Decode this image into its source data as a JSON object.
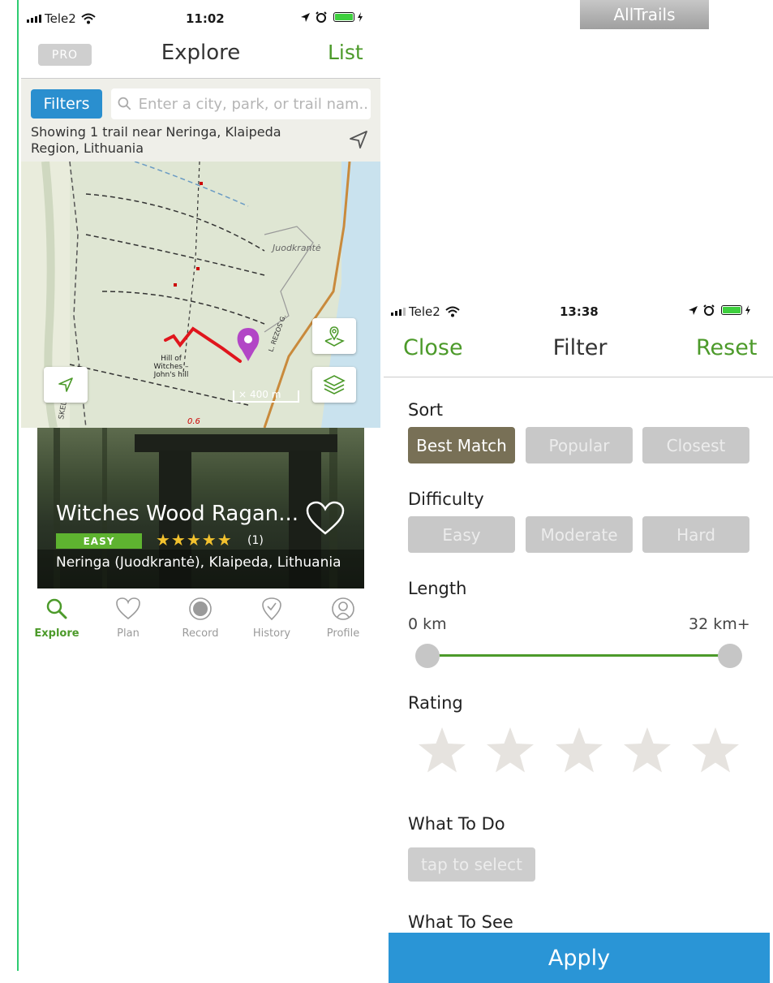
{
  "left_screen": {
    "status": {
      "carrier": "Tele2",
      "time": "11:02"
    },
    "nav": {
      "pro_label": "PRO",
      "title": "Explore",
      "list_label": "List"
    },
    "search": {
      "filters_label": "Filters",
      "placeholder": "Enter a city, park, or trail nam..."
    },
    "showing_text": "Showing 1 trail near Neringa, Klaipeda Region, Lithuania",
    "map": {
      "town_label": "Juodkrantė",
      "landmark_label_1": "Hill of",
      "landmark_label_2": "Witches –",
      "landmark_label_3": "John's hill",
      "road_label": "L. REZOS G.",
      "scale_label": "400 m",
      "side_label": "SKEL",
      "distance_label": "0.6"
    },
    "trail_card": {
      "name": "Witches Wood Ragan...",
      "difficulty": "EASY",
      "stars": "★★★★★",
      "rating_count": "(1)",
      "location": "Neringa (Juodkrantė), Klaipeda, Lithuania"
    },
    "tabs": [
      {
        "label": "Explore",
        "icon": "search-icon",
        "active": true
      },
      {
        "label": "Plan",
        "icon": "heart-icon",
        "active": false
      },
      {
        "label": "Record",
        "icon": "record-icon",
        "active": false
      },
      {
        "label": "History",
        "icon": "history-icon",
        "active": false
      },
      {
        "label": "Profile",
        "icon": "profile-icon",
        "active": false
      }
    ]
  },
  "brand_banner": "AllTrails",
  "right_screen": {
    "status": {
      "carrier": "Tele2",
      "time": "13:38"
    },
    "nav": {
      "close_label": "Close",
      "title": "Filter",
      "reset_label": "Reset"
    },
    "sort": {
      "heading": "Sort",
      "options": [
        "Best Match",
        "Popular",
        "Closest"
      ],
      "selected": "Best Match"
    },
    "difficulty": {
      "heading": "Difficulty",
      "options": [
        "Easy",
        "Moderate",
        "Hard"
      ]
    },
    "length": {
      "heading": "Length",
      "min_label": "0 km",
      "max_label": "32 km+"
    },
    "rating": {
      "heading": "Rating",
      "stars": 5,
      "selected": 0
    },
    "what_to_do": {
      "heading": "What To Do",
      "button": "tap to select"
    },
    "what_to_see": {
      "heading": "What To See"
    },
    "apply_label": "Apply"
  },
  "colors": {
    "accent_green": "#4c9a2a",
    "filters_blue": "#2a8fcf",
    "apply_blue": "#2a95d6",
    "selected_pill": "#787056",
    "pill_grey": "#c8c8c8"
  }
}
